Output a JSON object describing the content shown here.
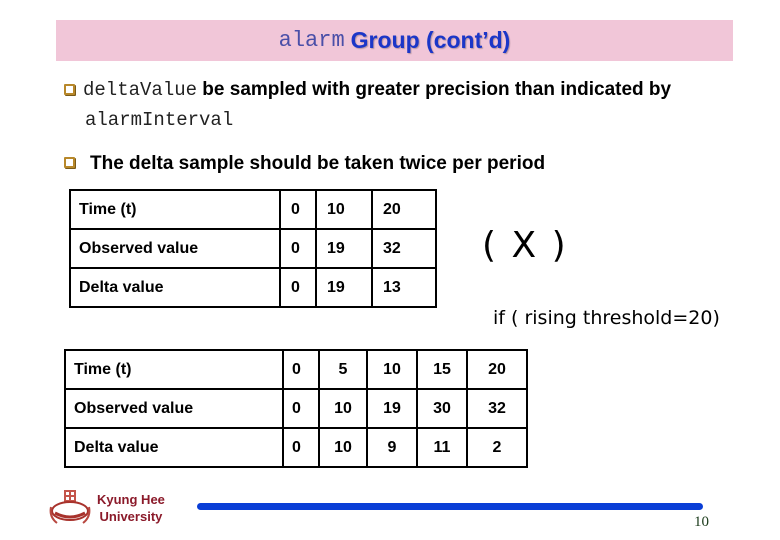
{
  "title": {
    "mono_part": "alarm",
    "main_part": "Group (cont’d)"
  },
  "bullets": [
    {
      "mono_lead": "deltaValue",
      "text": " be sampled with greater precision than indicated by",
      "mono_continuation": "alarmInterval"
    },
    {
      "text": "The delta sample should be taken twice per period"
    }
  ],
  "table1": {
    "rows": [
      {
        "label": "Time (t)",
        "values": [
          "0",
          "10",
          "20"
        ]
      },
      {
        "label": "Observed value",
        "values": [
          "0",
          "19",
          "32"
        ]
      },
      {
        "label": "Delta value",
        "values": [
          "0",
          "19",
          "13"
        ]
      }
    ]
  },
  "annotation": {
    "mark": "( X )",
    "condition": "if ( rising threshold=20)"
  },
  "table2": {
    "rows": [
      {
        "label": "Time (t)",
        "values": [
          "0",
          "5",
          "10",
          "15",
          "20"
        ]
      },
      {
        "label": "Observed value",
        "values": [
          "0",
          "10",
          "19",
          "30",
          "32"
        ]
      },
      {
        "label": "Delta value",
        "values": [
          "0",
          "10",
          "9",
          "11",
          "2"
        ]
      }
    ]
  },
  "footer": {
    "university_line1": "Kyung Hee",
    "university_line2": "University",
    "logo_icon": "university-emblem-icon",
    "page_number": "10",
    "accent_color": "#0a3ed6"
  }
}
